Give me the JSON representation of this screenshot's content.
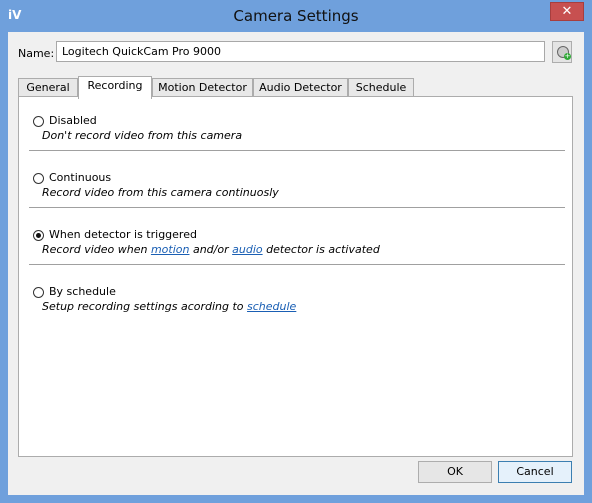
{
  "window": {
    "title": "Camera Settings",
    "app_icon": "iV",
    "close_glyph": "✕"
  },
  "name": {
    "label": "Name:",
    "value": "Logitech QuickCam Pro 9000"
  },
  "tabs": [
    {
      "label": "General"
    },
    {
      "label": "Recording"
    },
    {
      "label": "Motion Detector"
    },
    {
      "label": "Audio Detector"
    },
    {
      "label": "Schedule"
    }
  ],
  "active_tab": "Recording",
  "options": [
    {
      "label": "Disabled",
      "desc": "Don't record video from this camera",
      "checked": false
    },
    {
      "label": "Continuous",
      "desc": "Record video from this camera continuosly",
      "checked": false
    },
    {
      "label": "When detector is triggered",
      "desc_before": "Record video when ",
      "link1": "motion",
      "desc_mid": " and/or ",
      "link2": "audio",
      "desc_after": " detector is activated",
      "checked": true
    },
    {
      "label": "By schedule",
      "desc_before": "Setup recording settings acording to ",
      "link": "schedule",
      "checked": false
    }
  ],
  "buttons": {
    "ok": "OK",
    "cancel": "Cancel"
  },
  "icons": {
    "name_button": "webcam-add-icon"
  }
}
